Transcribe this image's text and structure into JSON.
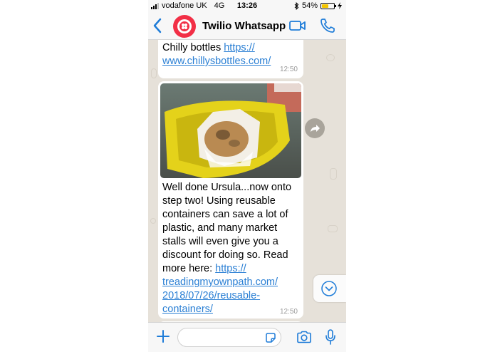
{
  "status_bar": {
    "carrier": "vodafone UK",
    "network": "4G",
    "time": "13:26",
    "battery_percent": "54%",
    "battery_level": 0.54,
    "battery_color": "#f3c500"
  },
  "header": {
    "contact_name": "Twilio Whatsapp",
    "back_icon": "chevron-left-icon",
    "video_icon": "video-camera-icon",
    "call_icon": "phone-icon",
    "accent_color": "#1e7cd8",
    "avatar_color": "#f22f46"
  },
  "messages": [
    {
      "text": "Chilly bottles ",
      "link": "https://\nwww.chillysbottles.com/",
      "time": "12:50"
    },
    {
      "image": "muffin in yellow container",
      "text_lines": [
        "Well done Ursula...now onto",
        "step two! Using reusable",
        "containers can save a lot of",
        "plastic, and many market",
        "stalls will even give you a",
        "discount for doing so. Read",
        "more here: "
      ],
      "link_lines": [
        "https://",
        "treadingmyownpath.com/",
        "2018/07/26/reusable-",
        "containers/"
      ],
      "time": "12:50"
    }
  ],
  "input_bar": {
    "placeholder": "",
    "plus_icon": "plus-icon",
    "sticker_icon": "sticker-icon",
    "camera_icon": "camera-icon",
    "mic_icon": "microphone-icon"
  }
}
